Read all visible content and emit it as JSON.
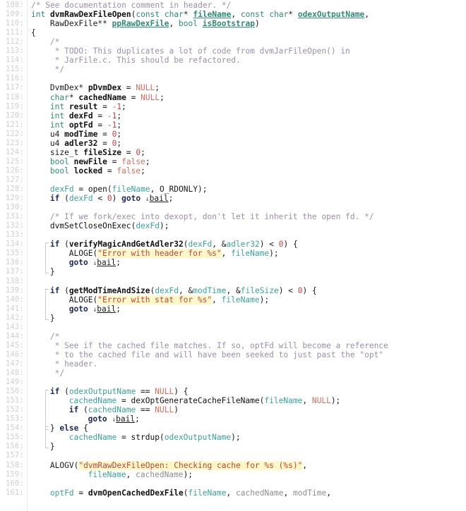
{
  "editor": {
    "title": "dvmRawDexFileOpen",
    "first_line": 108,
    "last_line": 161,
    "colors": {
      "background": "#ffffff",
      "line_number": "#cfcfcf",
      "comment": "#9b8fa6",
      "keyword": "#2e8b74",
      "control": "#222b5e",
      "variable": "#3aa39a",
      "constant": "#d4705f",
      "number": "#c94040",
      "string_text": "#c04545",
      "string_highlight": "#fdf8c8",
      "fold_bracket": "#c9c9c9",
      "gutter_rule": "#e6e6e6"
    }
  },
  "lines": [
    {
      "n": "108",
      "indent": 0,
      "tokens": [
        {
          "c": "cmt",
          "t": "/* See documentation comment in header. */"
        }
      ]
    },
    {
      "n": "109",
      "indent": 0,
      "tokens": [
        {
          "c": "kw",
          "t": "int"
        },
        {
          "c": "op",
          "t": " "
        },
        {
          "c": "fn",
          "t": "dvmRawDexFileOpen"
        },
        {
          "c": "op",
          "t": "("
        },
        {
          "c": "kw",
          "t": "const char"
        },
        {
          "c": "op",
          "t": "* "
        },
        {
          "c": "param",
          "t": "fileName"
        },
        {
          "c": "op",
          "t": ", "
        },
        {
          "c": "kw",
          "t": "const char"
        },
        {
          "c": "op",
          "t": "* "
        },
        {
          "c": "param",
          "t": "odexOutputName"
        },
        {
          "c": "op",
          "t": ","
        }
      ]
    },
    {
      "n": "110",
      "indent": 4,
      "tokens": [
        {
          "c": "op",
          "t": "RawDexFile** "
        },
        {
          "c": "param",
          "t": "ppRawDexFile"
        },
        {
          "c": "op",
          "t": ", "
        },
        {
          "c": "kw",
          "t": "bool"
        },
        {
          "c": "op",
          "t": " "
        },
        {
          "c": "param",
          "t": "isBootstrap"
        },
        {
          "c": "op",
          "t": ")"
        }
      ]
    },
    {
      "n": "111",
      "indent": 0,
      "tokens": [
        {
          "c": "op",
          "t": "{"
        }
      ]
    },
    {
      "n": "112",
      "indent": 4,
      "tokens": [
        {
          "c": "cmt",
          "t": "/*"
        }
      ]
    },
    {
      "n": "113",
      "indent": 4,
      "tokens": [
        {
          "c": "cmt",
          "t": " * TODO: This duplicates a lot of code from dvmJarFileOpen() in"
        }
      ]
    },
    {
      "n": "114",
      "indent": 4,
      "tokens": [
        {
          "c": "cmt",
          "t": " * JarFile.c. This should be refactored."
        }
      ]
    },
    {
      "n": "115",
      "indent": 4,
      "tokens": [
        {
          "c": "cmt",
          "t": " */"
        }
      ]
    },
    {
      "n": "116",
      "indent": 0,
      "tokens": []
    },
    {
      "n": "117",
      "indent": 4,
      "tokens": [
        {
          "c": "op",
          "t": "DvmDex* "
        },
        {
          "c": "fn",
          "t": "pDvmDex"
        },
        {
          "c": "op",
          "t": " = "
        },
        {
          "c": "cnst",
          "t": "NULL"
        },
        {
          "c": "op",
          "t": ";"
        }
      ]
    },
    {
      "n": "118",
      "indent": 4,
      "tokens": [
        {
          "c": "kw",
          "t": "char"
        },
        {
          "c": "op",
          "t": "* "
        },
        {
          "c": "fn",
          "t": "cachedName"
        },
        {
          "c": "op",
          "t": " = "
        },
        {
          "c": "cnst",
          "t": "NULL"
        },
        {
          "c": "op",
          "t": ";"
        }
      ]
    },
    {
      "n": "119",
      "indent": 4,
      "tokens": [
        {
          "c": "kw",
          "t": "int"
        },
        {
          "c": "op",
          "t": " "
        },
        {
          "c": "fn",
          "t": "result"
        },
        {
          "c": "op",
          "t": " = "
        },
        {
          "c": "num",
          "t": "-1"
        },
        {
          "c": "op",
          "t": ";"
        }
      ]
    },
    {
      "n": "120",
      "indent": 4,
      "tokens": [
        {
          "c": "kw",
          "t": "int"
        },
        {
          "c": "op",
          "t": " "
        },
        {
          "c": "fn",
          "t": "dexFd"
        },
        {
          "c": "op",
          "t": " = "
        },
        {
          "c": "num",
          "t": "-1"
        },
        {
          "c": "op",
          "t": ";"
        }
      ]
    },
    {
      "n": "121",
      "indent": 4,
      "tokens": [
        {
          "c": "kw",
          "t": "int"
        },
        {
          "c": "op",
          "t": " "
        },
        {
          "c": "fn",
          "t": "optFd"
        },
        {
          "c": "op",
          "t": " = "
        },
        {
          "c": "num",
          "t": "-1"
        },
        {
          "c": "op",
          "t": ";"
        }
      ]
    },
    {
      "n": "122",
      "indent": 4,
      "tokens": [
        {
          "c": "op",
          "t": "u4 "
        },
        {
          "c": "fn",
          "t": "modTime"
        },
        {
          "c": "op",
          "t": " = "
        },
        {
          "c": "num",
          "t": "0"
        },
        {
          "c": "op",
          "t": ";"
        }
      ]
    },
    {
      "n": "123",
      "indent": 4,
      "tokens": [
        {
          "c": "op",
          "t": "u4 "
        },
        {
          "c": "fn",
          "t": "adler32"
        },
        {
          "c": "op",
          "t": " = "
        },
        {
          "c": "num",
          "t": "0"
        },
        {
          "c": "op",
          "t": ";"
        }
      ]
    },
    {
      "n": "124",
      "indent": 4,
      "tokens": [
        {
          "c": "op",
          "t": "size_t "
        },
        {
          "c": "fn",
          "t": "fileSize"
        },
        {
          "c": "op",
          "t": " = "
        },
        {
          "c": "num",
          "t": "0"
        },
        {
          "c": "op",
          "t": ";"
        }
      ]
    },
    {
      "n": "125",
      "indent": 4,
      "tokens": [
        {
          "c": "kw",
          "t": "bool"
        },
        {
          "c": "op",
          "t": " "
        },
        {
          "c": "fn",
          "t": "newFile"
        },
        {
          "c": "op",
          "t": " = "
        },
        {
          "c": "cnst",
          "t": "false"
        },
        {
          "c": "op",
          "t": ";"
        }
      ]
    },
    {
      "n": "126",
      "indent": 4,
      "tokens": [
        {
          "c": "kw",
          "t": "bool"
        },
        {
          "c": "op",
          "t": " "
        },
        {
          "c": "fn",
          "t": "locked"
        },
        {
          "c": "op",
          "t": " = "
        },
        {
          "c": "cnst",
          "t": "false"
        },
        {
          "c": "op",
          "t": ";"
        }
      ]
    },
    {
      "n": "127",
      "indent": 0,
      "tokens": []
    },
    {
      "n": "128",
      "indent": 4,
      "tokens": [
        {
          "c": "var",
          "t": "dexFd"
        },
        {
          "c": "op",
          "t": " = "
        },
        {
          "c": "fnp",
          "t": "open"
        },
        {
          "c": "op",
          "t": "("
        },
        {
          "c": "var",
          "t": "fileName"
        },
        {
          "c": "op",
          "t": ", O_RDONLY);"
        }
      ]
    },
    {
      "n": "129",
      "indent": 4,
      "tokens": [
        {
          "c": "ctl",
          "t": "if"
        },
        {
          "c": "op",
          "t": " ("
        },
        {
          "c": "var",
          "t": "dexFd"
        },
        {
          "c": "op",
          "t": " < "
        },
        {
          "c": "num",
          "t": "0"
        },
        {
          "c": "op",
          "t": ") "
        },
        {
          "c": "ctl",
          "t": "goto"
        },
        {
          "c": "op",
          "t": " "
        },
        {
          "c": "arrow",
          "t": "↓"
        },
        {
          "c": "label",
          "t": "bail"
        },
        {
          "c": "op",
          "t": ";"
        }
      ]
    },
    {
      "n": "130",
      "indent": 0,
      "tokens": []
    },
    {
      "n": "131",
      "indent": 4,
      "tokens": [
        {
          "c": "cmt",
          "t": "/* If we fork/exec into dexopt, don't let it inherit the open fd. */"
        }
      ]
    },
    {
      "n": "132",
      "indent": 4,
      "tokens": [
        {
          "c": "fnp",
          "t": "dvmSetCloseOnExec"
        },
        {
          "c": "op",
          "t": "("
        },
        {
          "c": "var",
          "t": "dexFd"
        },
        {
          "c": "op",
          "t": ");"
        }
      ]
    },
    {
      "n": "133",
      "indent": 0,
      "tokens": []
    },
    {
      "n": "134",
      "indent": 4,
      "tokens": [
        {
          "c": "ctl",
          "t": "if"
        },
        {
          "c": "op",
          "t": " ("
        },
        {
          "c": "fn",
          "t": "verifyMagicAndGetAdler32"
        },
        {
          "c": "op",
          "t": "("
        },
        {
          "c": "var",
          "t": "dexFd"
        },
        {
          "c": "op",
          "t": ", &"
        },
        {
          "c": "var",
          "t": "adler32"
        },
        {
          "c": "op",
          "t": ") < "
        },
        {
          "c": "num",
          "t": "0"
        },
        {
          "c": "op",
          "t": ") {"
        }
      ]
    },
    {
      "n": "135",
      "indent": 8,
      "tokens": [
        {
          "c": "mac",
          "t": "ALOGE"
        },
        {
          "c": "op",
          "t": "("
        },
        {
          "c": "str",
          "t": "\"Error with header for %s\""
        },
        {
          "c": "op",
          "t": ", "
        },
        {
          "c": "var",
          "t": "fileName"
        },
        {
          "c": "op",
          "t": ");"
        }
      ]
    },
    {
      "n": "136",
      "indent": 8,
      "tokens": [
        {
          "c": "ctl",
          "t": "goto"
        },
        {
          "c": "op",
          "t": " "
        },
        {
          "c": "arrow",
          "t": "↓"
        },
        {
          "c": "label",
          "t": "bail"
        },
        {
          "c": "op",
          "t": ";"
        }
      ]
    },
    {
      "n": "137",
      "indent": 4,
      "tokens": [
        {
          "c": "op",
          "t": "}"
        }
      ]
    },
    {
      "n": "138",
      "indent": 0,
      "tokens": []
    },
    {
      "n": "139",
      "indent": 4,
      "tokens": [
        {
          "c": "ctl",
          "t": "if"
        },
        {
          "c": "op",
          "t": " ("
        },
        {
          "c": "fn",
          "t": "getModTimeAndSize"
        },
        {
          "c": "op",
          "t": "("
        },
        {
          "c": "var",
          "t": "dexFd"
        },
        {
          "c": "op",
          "t": ", &"
        },
        {
          "c": "var",
          "t": "modTime"
        },
        {
          "c": "op",
          "t": ", &"
        },
        {
          "c": "var",
          "t": "fileSize"
        },
        {
          "c": "op",
          "t": ") < "
        },
        {
          "c": "num",
          "t": "0"
        },
        {
          "c": "op",
          "t": ") {"
        }
      ]
    },
    {
      "n": "140",
      "indent": 8,
      "tokens": [
        {
          "c": "mac",
          "t": "ALOGE"
        },
        {
          "c": "op",
          "t": "("
        },
        {
          "c": "str",
          "t": "\"Error with stat for %s\""
        },
        {
          "c": "op",
          "t": ", "
        },
        {
          "c": "var",
          "t": "fileName"
        },
        {
          "c": "op",
          "t": ");"
        }
      ]
    },
    {
      "n": "141",
      "indent": 8,
      "tokens": [
        {
          "c": "ctl",
          "t": "goto"
        },
        {
          "c": "op",
          "t": " "
        },
        {
          "c": "arrow",
          "t": "↓"
        },
        {
          "c": "label",
          "t": "bail"
        },
        {
          "c": "op",
          "t": ";"
        }
      ]
    },
    {
      "n": "142",
      "indent": 4,
      "tokens": [
        {
          "c": "op",
          "t": "}"
        }
      ]
    },
    {
      "n": "143",
      "indent": 0,
      "tokens": []
    },
    {
      "n": "144",
      "indent": 4,
      "tokens": [
        {
          "c": "cmt",
          "t": "/*"
        }
      ]
    },
    {
      "n": "145",
      "indent": 4,
      "tokens": [
        {
          "c": "cmt",
          "t": " * See if the cached file matches. If so, optFd will become a reference"
        }
      ]
    },
    {
      "n": "146",
      "indent": 4,
      "tokens": [
        {
          "c": "cmt",
          "t": " * to the cached file and will have been seeked to just past the \"opt\""
        }
      ]
    },
    {
      "n": "147",
      "indent": 4,
      "tokens": [
        {
          "c": "cmt",
          "t": " * header."
        }
      ]
    },
    {
      "n": "148",
      "indent": 4,
      "tokens": [
        {
          "c": "cmt",
          "t": " */"
        }
      ]
    },
    {
      "n": "149",
      "indent": 0,
      "tokens": []
    },
    {
      "n": "150",
      "indent": 4,
      "tokens": [
        {
          "c": "ctl",
          "t": "if"
        },
        {
          "c": "op",
          "t": " ("
        },
        {
          "c": "var",
          "t": "odexOutputName"
        },
        {
          "c": "op",
          "t": " == "
        },
        {
          "c": "cnst",
          "t": "NULL"
        },
        {
          "c": "op",
          "t": ") {"
        }
      ]
    },
    {
      "n": "151",
      "indent": 8,
      "tokens": [
        {
          "c": "var",
          "t": "cachedName"
        },
        {
          "c": "op",
          "t": " = "
        },
        {
          "c": "fnp",
          "t": "dexOptGenerateCacheFileName"
        },
        {
          "c": "op",
          "t": "("
        },
        {
          "c": "var",
          "t": "fileName"
        },
        {
          "c": "op",
          "t": ", "
        },
        {
          "c": "cnst",
          "t": "NULL"
        },
        {
          "c": "op",
          "t": ");"
        }
      ]
    },
    {
      "n": "152",
      "indent": 8,
      "tokens": [
        {
          "c": "ctl",
          "t": "if"
        },
        {
          "c": "op",
          "t": " ("
        },
        {
          "c": "var",
          "t": "cachedName"
        },
        {
          "c": "op",
          "t": " == "
        },
        {
          "c": "cnst",
          "t": "NULL"
        },
        {
          "c": "op",
          "t": ")"
        }
      ]
    },
    {
      "n": "153",
      "indent": 12,
      "tokens": [
        {
          "c": "ctl",
          "t": "goto"
        },
        {
          "c": "op",
          "t": " "
        },
        {
          "c": "arrow",
          "t": "↓"
        },
        {
          "c": "label",
          "t": "bail"
        },
        {
          "c": "op",
          "t": ";"
        }
      ]
    },
    {
      "n": "154",
      "indent": 4,
      "tokens": [
        {
          "c": "op",
          "t": "} "
        },
        {
          "c": "ctl",
          "t": "else"
        },
        {
          "c": "op",
          "t": " {"
        }
      ]
    },
    {
      "n": "155",
      "indent": 8,
      "tokens": [
        {
          "c": "var",
          "t": "cachedName"
        },
        {
          "c": "op",
          "t": " = "
        },
        {
          "c": "fnp",
          "t": "strdup"
        },
        {
          "c": "op",
          "t": "("
        },
        {
          "c": "var",
          "t": "odexOutputName"
        },
        {
          "c": "op",
          "t": ");"
        }
      ]
    },
    {
      "n": "156",
      "indent": 4,
      "tokens": [
        {
          "c": "op",
          "t": "}"
        }
      ]
    },
    {
      "n": "157",
      "indent": 0,
      "tokens": []
    },
    {
      "n": "158",
      "indent": 4,
      "tokens": [
        {
          "c": "mac",
          "t": "ALOGV"
        },
        {
          "c": "op",
          "t": "("
        },
        {
          "c": "str",
          "t": "\"dvmRawDexFileOpen: Checking cache for %s (%s)\""
        },
        {
          "c": "op",
          "t": ","
        }
      ]
    },
    {
      "n": "159",
      "indent": 12,
      "tokens": [
        {
          "c": "var",
          "t": "fileName"
        },
        {
          "c": "op",
          "t": ", "
        },
        {
          "c": "varg",
          "t": "cachedName"
        },
        {
          "c": "op",
          "t": ");"
        }
      ]
    },
    {
      "n": "160",
      "indent": 0,
      "tokens": []
    },
    {
      "n": "161",
      "indent": 4,
      "tokens": [
        {
          "c": "var",
          "t": "optFd"
        },
        {
          "c": "op",
          "t": " = "
        },
        {
          "c": "fn",
          "t": "dvmOpenCachedDexFile"
        },
        {
          "c": "op",
          "t": "("
        },
        {
          "c": "var",
          "t": "fileName"
        },
        {
          "c": "op",
          "t": ", "
        },
        {
          "c": "varg",
          "t": "cachedName"
        },
        {
          "c": "op",
          "t": ", "
        },
        {
          "c": "varg",
          "t": "modTime"
        },
        {
          "c": "op",
          "t": ","
        }
      ]
    }
  ],
  "fold_brackets": [
    {
      "start_line": "134",
      "end_line": "137",
      "indent": 4
    },
    {
      "start_line": "139",
      "end_line": "142",
      "indent": 4
    },
    {
      "start_line": "150",
      "end_line": "154",
      "indent": 4
    },
    {
      "start_line": "154",
      "end_line": "156",
      "indent": 4
    }
  ]
}
